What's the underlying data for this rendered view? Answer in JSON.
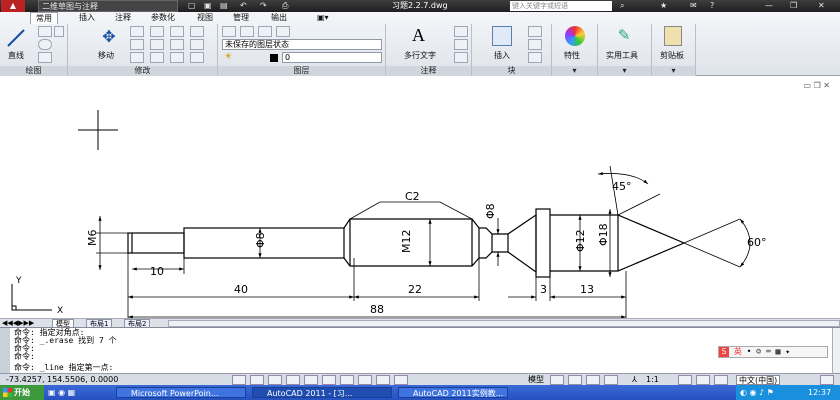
{
  "titlebar": {
    "workspace": "二维草图与注释",
    "file_title": "习题2.2.7.dwg",
    "search_placeholder": "键入关键字或短语"
  },
  "ribbon": {
    "tabs": [
      "常用",
      "插入",
      "注释",
      "参数化",
      "视图",
      "管理",
      "输出"
    ],
    "panels": {
      "draw": {
        "title": "绘图",
        "line_label": "直线"
      },
      "modify": {
        "title": "修改",
        "move_label": "移动"
      },
      "layers": {
        "title": "图层",
        "layer_state": "未保存的图层状态",
        "current_layer": "0"
      },
      "annotation": {
        "title": "注释",
        "mtext_label": "多行文字"
      },
      "block": {
        "title": "块",
        "insert_label": "插入"
      },
      "properties": {
        "label": "特性"
      },
      "utilities": {
        "label": "实用工具"
      },
      "clipboard": {
        "label": "剪贴板"
      }
    }
  },
  "drawing": {
    "dims": {
      "c2": "C2",
      "m6": "M6",
      "d8a": "Φ8",
      "m12": "M12",
      "d8b": "Φ8",
      "d12": "Φ12",
      "d18": "Φ18",
      "angle45": "45°",
      "angle60": "60°",
      "len10": "10",
      "len40": "40",
      "len22": "22",
      "len3": "3",
      "len13": "13",
      "len88": "88"
    },
    "ucs": {
      "y": "Y",
      "x": "X"
    }
  },
  "layout_tabs": [
    "模型",
    "布局1",
    "布局2"
  ],
  "command_lines": [
    "命令: 指定对角点:",
    "命令: _.erase 找到 7 个",
    "命令:",
    "命令:",
    "命令: _line 指定第一点:"
  ],
  "statusbar": {
    "coords": "-73.4257, 154.5506, 0.0000",
    "model": "模型",
    "scale": "1:1"
  },
  "ime": {
    "label": "英"
  },
  "taskbar": {
    "start": "开始",
    "items": [
      "Microsoft PowerPoin...",
      "AutoCAD 2011 - [习...",
      "AutoCAD 2011实例教..."
    ],
    "lang": "中文(中国)",
    "time": "12:37"
  },
  "colors": {
    "accent": "#2551c0",
    "titlebar": "#2b2b2b"
  }
}
